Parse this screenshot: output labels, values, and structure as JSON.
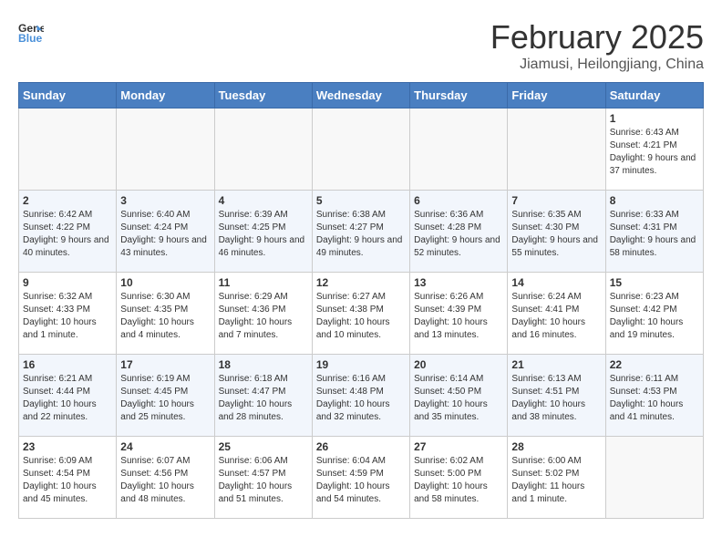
{
  "header": {
    "logo_line1": "General",
    "logo_line2": "Blue",
    "title": "February 2025",
    "subtitle": "Jiamusi, Heilongjiang, China"
  },
  "weekdays": [
    "Sunday",
    "Monday",
    "Tuesday",
    "Wednesday",
    "Thursday",
    "Friday",
    "Saturday"
  ],
  "weeks": [
    [
      {
        "day": "",
        "info": ""
      },
      {
        "day": "",
        "info": ""
      },
      {
        "day": "",
        "info": ""
      },
      {
        "day": "",
        "info": ""
      },
      {
        "day": "",
        "info": ""
      },
      {
        "day": "",
        "info": ""
      },
      {
        "day": "1",
        "info": "Sunrise: 6:43 AM\nSunset: 4:21 PM\nDaylight: 9 hours and 37 minutes."
      }
    ],
    [
      {
        "day": "2",
        "info": "Sunrise: 6:42 AM\nSunset: 4:22 PM\nDaylight: 9 hours and 40 minutes."
      },
      {
        "day": "3",
        "info": "Sunrise: 6:40 AM\nSunset: 4:24 PM\nDaylight: 9 hours and 43 minutes."
      },
      {
        "day": "4",
        "info": "Sunrise: 6:39 AM\nSunset: 4:25 PM\nDaylight: 9 hours and 46 minutes."
      },
      {
        "day": "5",
        "info": "Sunrise: 6:38 AM\nSunset: 4:27 PM\nDaylight: 9 hours and 49 minutes."
      },
      {
        "day": "6",
        "info": "Sunrise: 6:36 AM\nSunset: 4:28 PM\nDaylight: 9 hours and 52 minutes."
      },
      {
        "day": "7",
        "info": "Sunrise: 6:35 AM\nSunset: 4:30 PM\nDaylight: 9 hours and 55 minutes."
      },
      {
        "day": "8",
        "info": "Sunrise: 6:33 AM\nSunset: 4:31 PM\nDaylight: 9 hours and 58 minutes."
      }
    ],
    [
      {
        "day": "9",
        "info": "Sunrise: 6:32 AM\nSunset: 4:33 PM\nDaylight: 10 hours and 1 minute."
      },
      {
        "day": "10",
        "info": "Sunrise: 6:30 AM\nSunset: 4:35 PM\nDaylight: 10 hours and 4 minutes."
      },
      {
        "day": "11",
        "info": "Sunrise: 6:29 AM\nSunset: 4:36 PM\nDaylight: 10 hours and 7 minutes."
      },
      {
        "day": "12",
        "info": "Sunrise: 6:27 AM\nSunset: 4:38 PM\nDaylight: 10 hours and 10 minutes."
      },
      {
        "day": "13",
        "info": "Sunrise: 6:26 AM\nSunset: 4:39 PM\nDaylight: 10 hours and 13 minutes."
      },
      {
        "day": "14",
        "info": "Sunrise: 6:24 AM\nSunset: 4:41 PM\nDaylight: 10 hours and 16 minutes."
      },
      {
        "day": "15",
        "info": "Sunrise: 6:23 AM\nSunset: 4:42 PM\nDaylight: 10 hours and 19 minutes."
      }
    ],
    [
      {
        "day": "16",
        "info": "Sunrise: 6:21 AM\nSunset: 4:44 PM\nDaylight: 10 hours and 22 minutes."
      },
      {
        "day": "17",
        "info": "Sunrise: 6:19 AM\nSunset: 4:45 PM\nDaylight: 10 hours and 25 minutes."
      },
      {
        "day": "18",
        "info": "Sunrise: 6:18 AM\nSunset: 4:47 PM\nDaylight: 10 hours and 28 minutes."
      },
      {
        "day": "19",
        "info": "Sunrise: 6:16 AM\nSunset: 4:48 PM\nDaylight: 10 hours and 32 minutes."
      },
      {
        "day": "20",
        "info": "Sunrise: 6:14 AM\nSunset: 4:50 PM\nDaylight: 10 hours and 35 minutes."
      },
      {
        "day": "21",
        "info": "Sunrise: 6:13 AM\nSunset: 4:51 PM\nDaylight: 10 hours and 38 minutes."
      },
      {
        "day": "22",
        "info": "Sunrise: 6:11 AM\nSunset: 4:53 PM\nDaylight: 10 hours and 41 minutes."
      }
    ],
    [
      {
        "day": "23",
        "info": "Sunrise: 6:09 AM\nSunset: 4:54 PM\nDaylight: 10 hours and 45 minutes."
      },
      {
        "day": "24",
        "info": "Sunrise: 6:07 AM\nSunset: 4:56 PM\nDaylight: 10 hours and 48 minutes."
      },
      {
        "day": "25",
        "info": "Sunrise: 6:06 AM\nSunset: 4:57 PM\nDaylight: 10 hours and 51 minutes."
      },
      {
        "day": "26",
        "info": "Sunrise: 6:04 AM\nSunset: 4:59 PM\nDaylight: 10 hours and 54 minutes."
      },
      {
        "day": "27",
        "info": "Sunrise: 6:02 AM\nSunset: 5:00 PM\nDaylight: 10 hours and 58 minutes."
      },
      {
        "day": "28",
        "info": "Sunrise: 6:00 AM\nSunset: 5:02 PM\nDaylight: 11 hours and 1 minute."
      },
      {
        "day": "",
        "info": ""
      }
    ]
  ]
}
